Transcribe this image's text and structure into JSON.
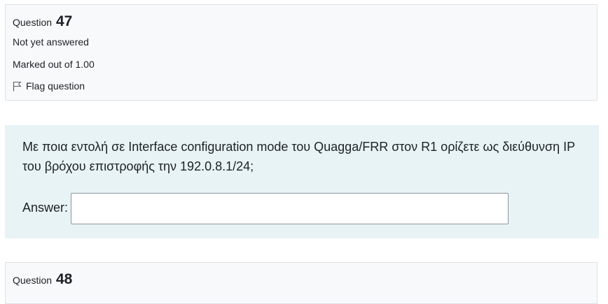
{
  "question_47": {
    "prefix": "Question",
    "number": "47",
    "state": "Not yet answered",
    "grade": "Marked out of 1.00",
    "flag_label": "Flag question",
    "text": "Με ποια εντολή σε Interface configuration mode του Quagga/FRR στον R1 ορίζετε ως διεύθυνση IP του βρόχου επιστροφής την 192.0.8.1/24;",
    "answer_label": "Answer:",
    "answer_value": ""
  },
  "question_48": {
    "prefix": "Question",
    "number": "48"
  },
  "colors": {
    "info_bg": "#f8f9fa",
    "content_bg": "#e7f3f5",
    "border": "#dee2e6"
  },
  "icons": {
    "flag": "flag-outline-icon"
  }
}
